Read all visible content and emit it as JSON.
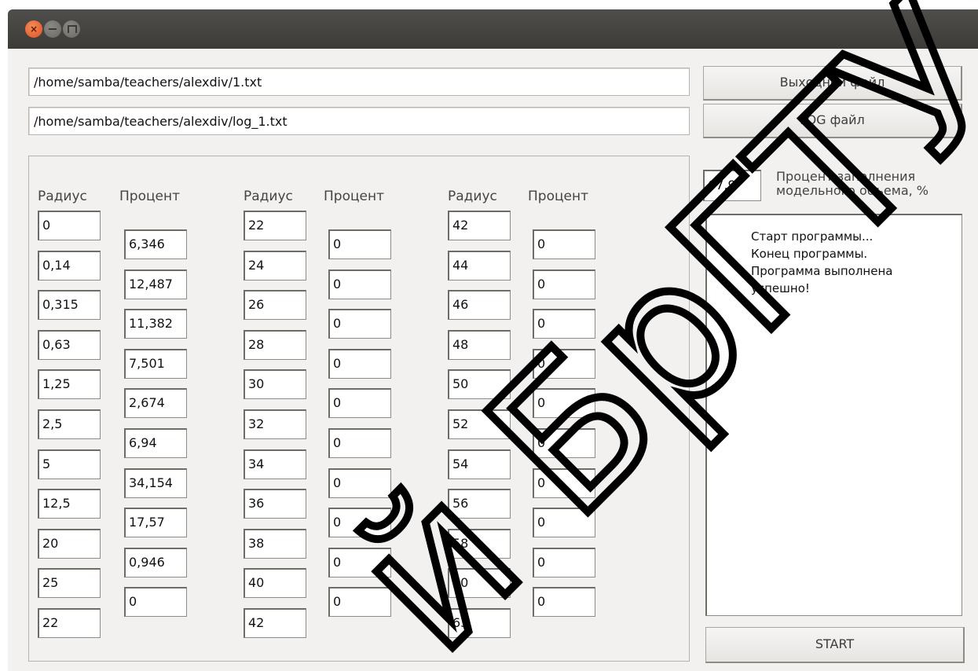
{
  "window_controls": {
    "close": "×"
  },
  "paths": {
    "output_file": "/home/samba/teachers/alexdiv/1.txt",
    "log_file": "/home/samba/teachers/alexdiv/log_1.txt"
  },
  "buttons": {
    "output": "Выходной файл",
    "log": "LOG файл",
    "start": "START"
  },
  "headers": {
    "radius": "Радиус",
    "percent": "Процент"
  },
  "columns": [
    {
      "radius": [
        "0",
        "0,14",
        "0,315",
        "0,63",
        "1,25",
        "2,5",
        "5",
        "12,5",
        "20",
        "25",
        "22"
      ],
      "percent": [
        "6,346",
        "12,487",
        "11,382",
        "7,501",
        "2,674",
        "6,94",
        "34,154",
        "17,57",
        "0,946",
        "0"
      ]
    },
    {
      "radius": [
        "22",
        "24",
        "26",
        "28",
        "30",
        "32",
        "34",
        "36",
        "38",
        "40",
        "42"
      ],
      "percent": [
        "0",
        "0",
        "0",
        "0",
        "0",
        "0",
        "0",
        "0",
        "0",
        "0"
      ]
    },
    {
      "radius": [
        "42",
        "44",
        "46",
        "48",
        "50",
        "52",
        "54",
        "56",
        "58",
        "60",
        "63"
      ],
      "percent": [
        "0",
        "0",
        "0",
        "0",
        "0",
        "0",
        "0",
        "0",
        "0",
        "0"
      ]
    }
  ],
  "fill": {
    "value": "67,9",
    "label_line1": "Процент заполнения",
    "label_line2": "модельного объема, %"
  },
  "log": [
    "Старт программы...",
    "Конец программы.",
    "Программа выполнена",
    "успешно!"
  ],
  "watermark": "й БрГТУ"
}
